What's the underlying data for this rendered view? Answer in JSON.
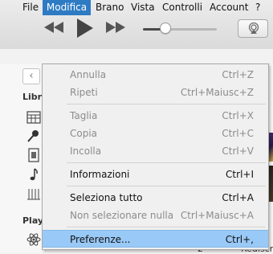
{
  "menubar": {
    "items": [
      "File",
      "Modifica",
      "Brano",
      "Vista",
      "Controlli",
      "Account",
      "?"
    ]
  },
  "sidebar": {
    "back_arrow": "‹",
    "library_header": "Libre",
    "playlist_header": "Playl"
  },
  "content": {
    "track_number": "2",
    "track_name": "Rediscr"
  },
  "edit_menu": {
    "items": [
      {
        "label": "Annulla",
        "shortcut": "Ctrl+Z",
        "enabled": false
      },
      {
        "label": "Ripeti",
        "shortcut": "Ctrl+Maiusc+Z",
        "enabled": false
      },
      {
        "label": "Taglia",
        "shortcut": "Ctrl+X",
        "enabled": false
      },
      {
        "label": "Copia",
        "shortcut": "Ctrl+C",
        "enabled": false
      },
      {
        "label": "Incolla",
        "shortcut": "Ctrl+V",
        "enabled": false
      },
      {
        "label": "Informazioni",
        "shortcut": "Ctrl+I",
        "enabled": true
      },
      {
        "label": "Seleziona tutto",
        "shortcut": "Ctrl+A",
        "enabled": true
      },
      {
        "label": "Non selezionare nulla",
        "shortcut": "Ctrl+Maiusc+A",
        "enabled": false
      },
      {
        "label": "Preferenze...",
        "shortcut": "Ctrl+,",
        "enabled": true,
        "highlighted": true
      }
    ]
  },
  "colors": {
    "menu_active_bg": "#2e7bc4",
    "highlight_bg": "#99c9f6",
    "disabled_text": "#8c8c8c"
  },
  "icons": [
    "previous-icon",
    "play-icon",
    "next-icon",
    "airplay-icon",
    "grid-icon",
    "microphone-icon",
    "film-icon",
    "music-note-icon",
    "podcast-icon",
    "atom-icon"
  ]
}
